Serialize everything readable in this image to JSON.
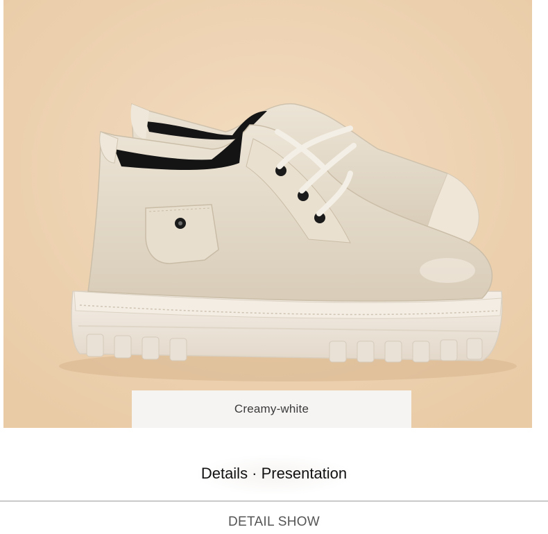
{
  "product_image": {
    "subject": "shoe-photo",
    "background_color": "#efd3b1",
    "shoe_color": "#e5dccc"
  },
  "color_option": {
    "label": "Creamy-white"
  },
  "section": {
    "title": "Details · Presentation",
    "subtitle": "DETAIL SHOW"
  }
}
